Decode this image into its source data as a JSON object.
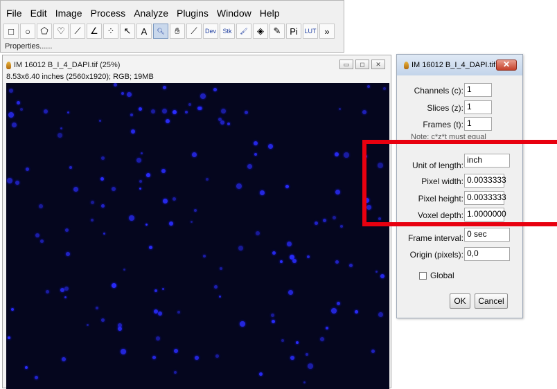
{
  "main_window": {
    "menu": [
      "File",
      "Edit",
      "Image",
      "Process",
      "Analyze",
      "Plugins",
      "Window",
      "Help"
    ],
    "tools": [
      {
        "name": "rectangle-tool-icon",
        "glyph": "□"
      },
      {
        "name": "oval-tool-icon",
        "glyph": "○"
      },
      {
        "name": "polygon-tool-icon",
        "glyph": "⬠"
      },
      {
        "name": "freehand-tool-icon",
        "glyph": "♡"
      },
      {
        "name": "line-tool-icon",
        "glyph": "⟋"
      },
      {
        "name": "angle-tool-icon",
        "glyph": "∠"
      },
      {
        "name": "point-tool-icon",
        "glyph": "⁘"
      },
      {
        "name": "wand-tool-icon",
        "glyph": "↖"
      },
      {
        "name": "text-tool-icon",
        "glyph": "A"
      },
      {
        "name": "magnifier-tool-icon",
        "glyph": "🔍︎"
      },
      {
        "name": "hand-tool-icon",
        "glyph": "✋︎"
      },
      {
        "name": "dropper-tool-icon",
        "glyph": "⟋"
      },
      {
        "name": "dev-tool-icon",
        "glyph": "Dev"
      },
      {
        "name": "stk-tool-icon",
        "glyph": "Stk"
      },
      {
        "name": "brush-tool-icon",
        "glyph": "🖌︎"
      },
      {
        "name": "fill-tool-icon",
        "glyph": "◈"
      },
      {
        "name": "pencil-tool-icon",
        "glyph": "✎"
      },
      {
        "name": "pick-tool-icon",
        "glyph": "Pi"
      },
      {
        "name": "lut-tool-icon",
        "glyph": "LUT"
      },
      {
        "name": "more-tools-icon",
        "glyph": "»"
      }
    ],
    "status": "Properties......"
  },
  "image_window": {
    "title": "IM 16012 B_I_4_DAPI.tif (25%)",
    "info": "8.53x6.40 inches (2560x1920); RGB; 19MB",
    "background_color": "#05061e",
    "nuclei_color": "#2a2cff"
  },
  "dialog": {
    "title": "IM 16012 B_I_4_DAPI.tif",
    "fields": {
      "channels": {
        "label": "Channels (c):",
        "value": "1"
      },
      "slices": {
        "label": "Slices (z):",
        "value": "1"
      },
      "frames": {
        "label": "Frames (t):",
        "value": "1"
      },
      "note": "Note: c*z*t must equal",
      "unit": {
        "label": "Unit of length:",
        "value": "inch"
      },
      "pixel_width": {
        "label": "Pixel width:",
        "value": "0.0033333"
      },
      "pixel_height": {
        "label": "Pixel height:",
        "value": "0.0033333"
      },
      "voxel_depth": {
        "label": "Voxel depth:",
        "value": "1.0000000"
      },
      "frame_interval": {
        "label": "Frame interval:",
        "value": "0 sec"
      },
      "origin": {
        "label": "Origin (pixels):",
        "value": "0,0"
      }
    },
    "global_label": "Global",
    "ok_label": "OK",
    "cancel_label": "Cancel"
  },
  "annotation": {
    "color": "#e8000f"
  }
}
